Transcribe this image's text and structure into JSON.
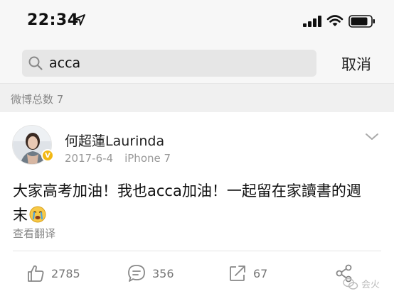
{
  "status_bar": {
    "time": "22:34",
    "icons": [
      "location-arrow-icon",
      "signal-bars-icon",
      "wifi-icon",
      "battery-icon"
    ]
  },
  "search": {
    "value": "acca",
    "cancel_label": "取消"
  },
  "results": {
    "count_label": "微博总数 7"
  },
  "post": {
    "author": "何超蓮Laurinda",
    "date": "2017-6-4",
    "device": "iPhone 7",
    "text_line1": "大家高考加油！我也acca加油！一起留在家讀書的週",
    "text_line2": "末",
    "emoji": "crying-face",
    "translate_label": "查看翻译",
    "verified": true
  },
  "actions": {
    "likes": "2785",
    "comments": "356",
    "reposts": "67"
  },
  "watermark": {
    "text": "会火"
  },
  "colors": {
    "background": "#ffffff",
    "bar_bg": "#f7f7f7",
    "search_bg": "#e6e6e6",
    "count_bar_bg": "#f0f0f0",
    "muted_text": "#888888",
    "verified_badge": "#f2b814"
  }
}
